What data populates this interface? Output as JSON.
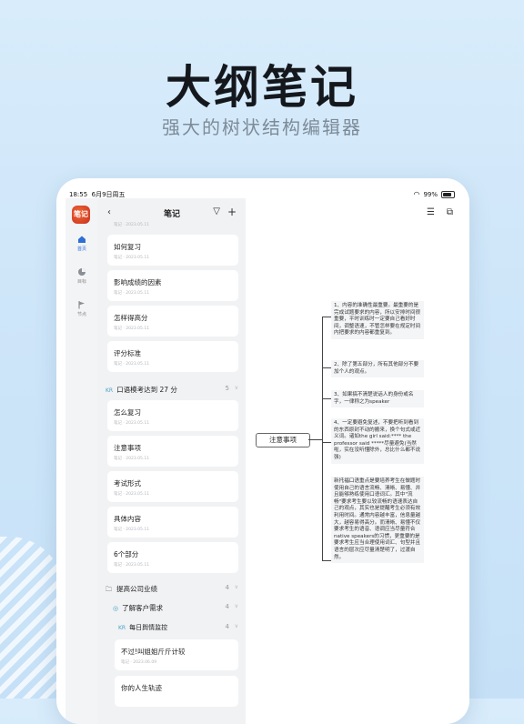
{
  "hero": {
    "title": "大纲笔记",
    "subtitle": "强大的树状结构编辑器"
  },
  "status_bar": {
    "time": "18:55",
    "date": "6月9日周五",
    "battery": "99%"
  },
  "rail": {
    "app_icon_text": "笔记",
    "items": [
      {
        "label": "首页",
        "icon": "home-icon",
        "active": true
      },
      {
        "label": "目标",
        "icon": "pie-chart-icon",
        "active": false
      },
      {
        "label": "节点",
        "icon": "flag-icon",
        "active": false
      }
    ]
  },
  "list": {
    "title": "笔记",
    "back_icon": "chevron-left-icon",
    "filter_icon": "filter-icon",
    "add_icon": "plus-icon",
    "top_meta": "笔记 · 2023.05.11",
    "cards_a": [
      {
        "title": "如何复习",
        "meta": "笔记 · 2023.05.11"
      },
      {
        "title": "影响成绩的因素",
        "meta": "笔记 · 2023.05.11"
      },
      {
        "title": "怎样得高分",
        "meta": "笔记 · 2023.05.11"
      },
      {
        "title": "评分标准",
        "meta": "笔记 · 2023.05.11"
      }
    ],
    "group_1": {
      "badge": "KR",
      "label": "口语模考达到 27 分",
      "count": "5"
    },
    "cards_b": [
      {
        "title": "怎么复习",
        "meta": "笔记 · 2023.05.11"
      },
      {
        "title": "注意事项",
        "meta": "笔记 · 2023.05.11"
      },
      {
        "title": "考试形式",
        "meta": "笔记 · 2023.05.11"
      },
      {
        "title": "具体内容",
        "meta": "笔记 · 2023.05.11"
      },
      {
        "title": "6个部分",
        "meta": "笔记 · 2023.05.11"
      }
    ],
    "group_2": {
      "label": "提高公司业绩",
      "count": "4"
    },
    "group_3": {
      "label": "了解客户需求",
      "count": "4"
    },
    "group_4": {
      "badge": "KR",
      "label": "每日舆情监控",
      "count": "4"
    },
    "cards_c": [
      {
        "title": "不过!叫姐姐斤斤计较",
        "meta": "笔记 · 2023.06.09"
      },
      {
        "title": "你的人生轨迹",
        "meta": ""
      }
    ]
  },
  "editor": {
    "outline_icon": "outline-list-icon",
    "export_icon": "export-icon",
    "root": "注意事项",
    "children": [
      "1、内容的准确性最重要。最重要的是完成试题要求的内容，所以安排时间很重要，平时训练时一定要自己看好时间，调整语速，不管怎样要在规定时间内把要求的内容都重复到。",
      "2、除了第五部分，所有其他部分不要加个人的观点。",
      "3、如果搞不清楚说话人的身份或名字，一律称之为speaker",
      "4、一定要避免复述，不要把听到看到的东西原封不动的搬来，换个句式或近义词。诸如the girl said:**** the professor said *****尽量避免(当然啦，实在没听懂除外，总比什么都不说强)",
      "新托福口语重点是要培养考生在做题时使用自己的语言流畅、清晰、易懂、并且能够熟练使用口语词汇。其中\"流畅\"要求考生要以较流畅的语速表达自己的观点，其实也是提醒考生必须有效利用时间。通常内容越丰富，信息量越大，越容易得高分。而清晰、易懂不仅要求考生的语音、语调应当尽量符合native speakers的习惯，更重要的是要求考生应当合理使用词汇、句型并且语言的层次应尽量清楚明了，过渡自然。"
    ]
  }
}
